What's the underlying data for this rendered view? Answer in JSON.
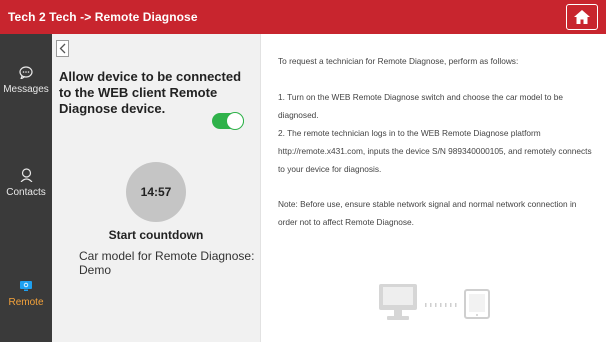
{
  "header": {
    "title": "Tech 2 Tech -> Remote Diagnose",
    "home_icon": "home-icon"
  },
  "sidebar": {
    "items": [
      {
        "label": "Messages",
        "icon": "message-bubble-icon",
        "active": false
      },
      {
        "label": "Contacts",
        "icon": "contact-person-icon",
        "active": false
      },
      {
        "label": "Remote",
        "icon": "remote-screen-icon",
        "active": true
      }
    ]
  },
  "left_panel": {
    "allow_text": "Allow device to be connected to the WEB client Remote Diagnose device.",
    "toggle_on": true,
    "timer": "14:57",
    "countdown_label": "Start countdown",
    "car_model": "Car model for Remote Diagnose: Demo"
  },
  "instructions": {
    "intro": "To request a technician for Remote Diagnose, perform as follows:",
    "step1": "1. Turn on the WEB Remote Diagnose switch and choose the car model to be diagnosed.",
    "step2": "2. The remote technician logs in to the WEB Remote Diagnose platform http://remote.x431.com, inputs the device S/N 989340000105, and remotely connects to your device for diagnosis.",
    "note": "Note: Before use, ensure stable network signal and normal network connection in order not to affect Remote Diagnose."
  },
  "colors": {
    "header_bg": "#c8252e",
    "sidebar_bg": "#3a3a3a",
    "active_accent": "#f4a23a",
    "toggle_on": "#2fb24a"
  }
}
